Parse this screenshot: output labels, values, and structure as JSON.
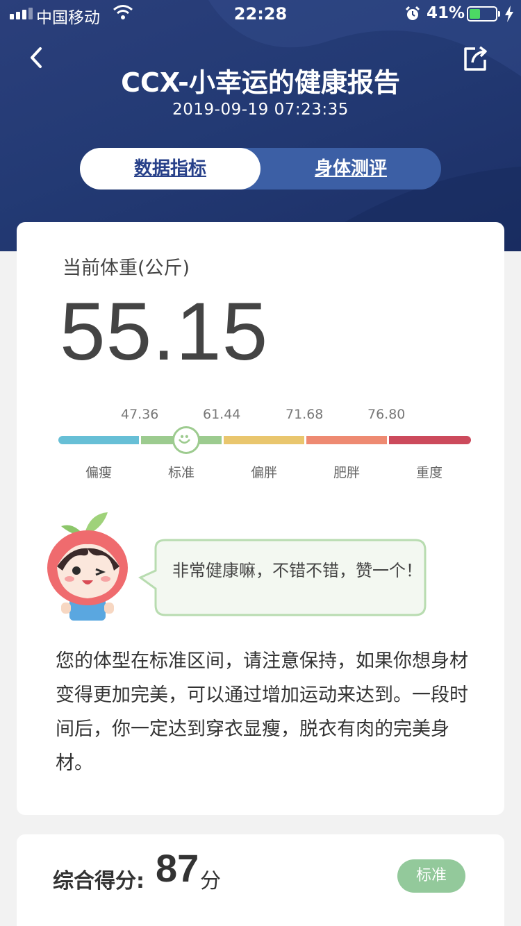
{
  "status_bar": {
    "carrier": "中国移动",
    "time": "22:28",
    "battery": "41%",
    "battery_level": 0.41,
    "icons": [
      "signal-icon",
      "wifi-icon",
      "alarm-icon",
      "battery-icon",
      "charging-icon"
    ]
  },
  "header": {
    "title": "CCX-小幸运的健康报告",
    "timestamp": "2019-09-19 07:23:35",
    "back_icon": "chevron-left-icon",
    "share_icon": "share-icon"
  },
  "tabs": [
    {
      "label": "数据指标",
      "active": true
    },
    {
      "label": "身体测评",
      "active": false
    }
  ],
  "weight": {
    "label": "当前体重(公斤)",
    "value": "55.15"
  },
  "scale": {
    "thresholds": [
      "47.36",
      "61.44",
      "71.68",
      "76.80"
    ],
    "categories": [
      "偏瘦",
      "标准",
      "偏胖",
      "肥胖",
      "重度"
    ],
    "colors": [
      "#67bfd6",
      "#9ccb8f",
      "#e9c66e",
      "#ee8a72",
      "#cc4a5c"
    ],
    "current_category": "标准"
  },
  "mascot": {
    "speech": "非常健康嘛，不错不错，赞一个！"
  },
  "description": "您的体型在标准区间，请注意保持，如果你想身材变得更加完美，可以通过增加运动来达到。一段时间后，你一定达到穿衣显瘦，脱衣有肉的完美身材。",
  "score": {
    "label": "综合得分:",
    "value": "87",
    "unit": "分",
    "badge": "标准"
  },
  "colors": {
    "header_bg": "#233a74",
    "tab_active_text": "#28418a",
    "badge_bg": "#93c99b",
    "bubble_border": "#b8dcb0"
  }
}
